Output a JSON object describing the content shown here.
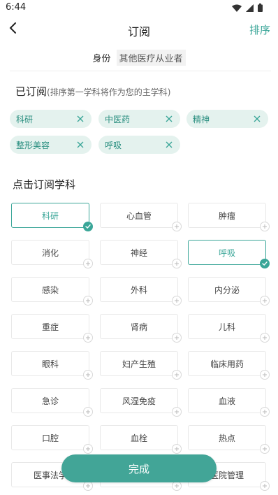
{
  "status_bar": {
    "time": "6:44"
  },
  "nav": {
    "title": "订阅",
    "sort_label": "排序"
  },
  "identity": {
    "label": "身份",
    "value": "其他医疗从业者"
  },
  "subscribed": {
    "title": "已订阅",
    "hint": "(排序第一学科将作为您的主学科)",
    "chips": [
      {
        "label": "科研"
      },
      {
        "label": "中医药"
      },
      {
        "label": "精神"
      },
      {
        "label": "整形美容"
      },
      {
        "label": "呼吸"
      }
    ]
  },
  "subjects": {
    "title": "点击订阅学科",
    "items": [
      {
        "label": "科研",
        "selected": true
      },
      {
        "label": "心血管",
        "selected": false
      },
      {
        "label": "肿瘤",
        "selected": false
      },
      {
        "label": "消化",
        "selected": false
      },
      {
        "label": "神经",
        "selected": false
      },
      {
        "label": "呼吸",
        "selected": true
      },
      {
        "label": "感染",
        "selected": false
      },
      {
        "label": "外科",
        "selected": false
      },
      {
        "label": "内分泌",
        "selected": false
      },
      {
        "label": "重症",
        "selected": false
      },
      {
        "label": "肾病",
        "selected": false
      },
      {
        "label": "儿科",
        "selected": false
      },
      {
        "label": "眼科",
        "selected": false
      },
      {
        "label": "妇产生殖",
        "selected": false
      },
      {
        "label": "临床用药",
        "selected": false
      },
      {
        "label": "急诊",
        "selected": false
      },
      {
        "label": "风湿免疫",
        "selected": false
      },
      {
        "label": "血液",
        "selected": false
      },
      {
        "label": "口腔",
        "selected": false
      },
      {
        "label": "血栓",
        "selected": false
      },
      {
        "label": "热点",
        "selected": false
      },
      {
        "label": "医事法学",
        "selected": false
      },
      {
        "label": "",
        "selected": false
      },
      {
        "label": "医院管理",
        "selected": false
      }
    ]
  },
  "done_label": "完成",
  "colors": {
    "accent": "#3aa698",
    "chip_bg": "#e4f2ee",
    "button_bg": "#42a597"
  }
}
